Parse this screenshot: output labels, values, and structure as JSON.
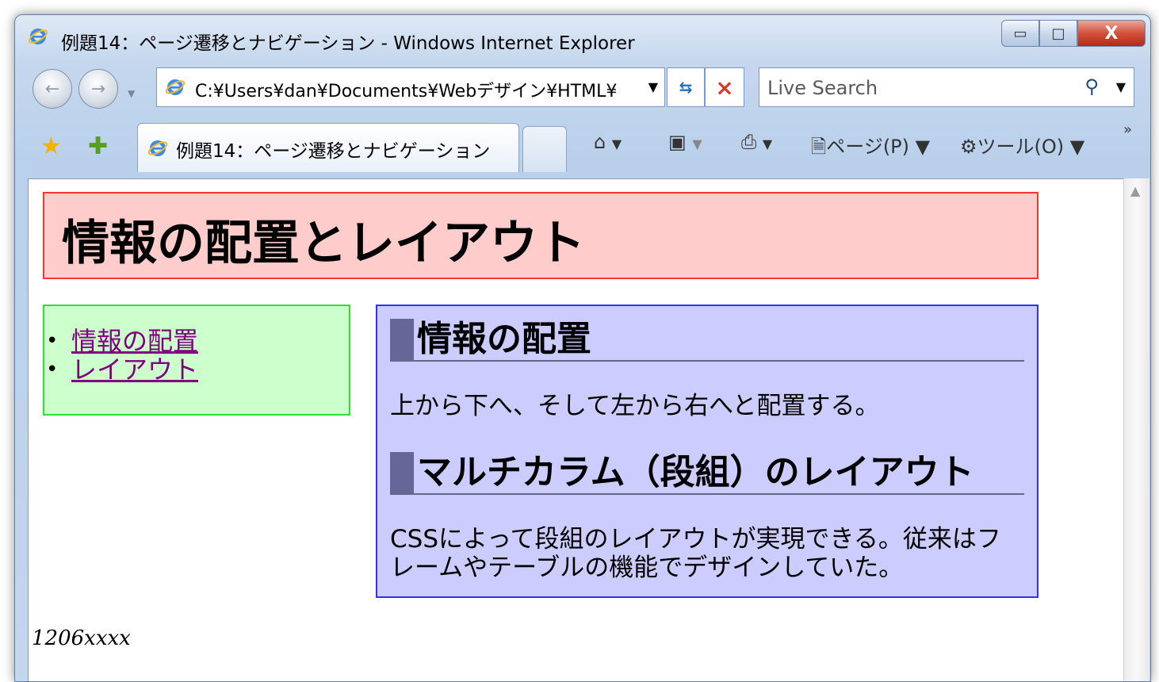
{
  "window": {
    "title": "例題14：ページ遷移とナビゲーション - Windows Internet Explorer",
    "minimize": "▭",
    "maximize": "□",
    "close": "X"
  },
  "navbar": {
    "address": "C:¥Users¥dan¥Documents¥Webデザイン¥HTML¥",
    "search_placeholder": "Live Search"
  },
  "commandbar": {
    "tab_title": "例題14：ページ遷移とナビゲーション",
    "page_menu": "ページ(P) ▼",
    "tools_menu": "ツール(O) ▼",
    "overflow": "»"
  },
  "page": {
    "header_title": "情報の配置とレイアウト",
    "nav_links": [
      "情報の配置",
      "レイアウト"
    ],
    "sections": [
      {
        "heading": "情報の配置",
        "body": "上から下へ、そして左から右へと配置する。"
      },
      {
        "heading": "マルチカラム（段組）のレイアウト",
        "body": "CSSによって段組のレイアウトが実現できる。従来はフレームやテーブルの機能でデザインしていた。"
      }
    ],
    "footer": "1206xxxx"
  },
  "colors": {
    "header_bg": "#ffcccc",
    "header_border": "#ff3333",
    "nav_bg": "#ccffcc",
    "nav_border": "#33dd33",
    "main_bg": "#ccccff",
    "main_border": "#3333ee",
    "link": "#800080"
  },
  "icons": [
    "ie-logo-icon",
    "back-icon",
    "forward-icon",
    "refresh-icon",
    "stop-icon",
    "search-icon",
    "favorites-star-icon",
    "add-favorites-icon",
    "home-icon",
    "feed-icon",
    "print-icon",
    "page-icon",
    "gear-icon"
  ]
}
